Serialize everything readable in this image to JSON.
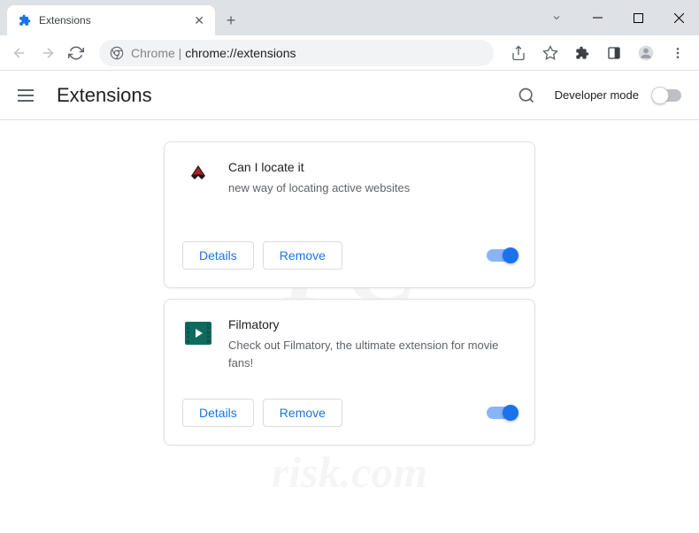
{
  "tab": {
    "title": "Extensions"
  },
  "address": {
    "prefix": "Chrome",
    "url": "chrome://extensions"
  },
  "header": {
    "title": "Extensions",
    "dev_mode": "Developer mode"
  },
  "buttons": {
    "details": "Details",
    "remove": "Remove"
  },
  "extensions": [
    {
      "name": "Can I locate it",
      "description": "new way of locating active websites",
      "enabled": true
    },
    {
      "name": "Filmatory",
      "description": "Check out Filmatory, the ultimate extension for movie fans!",
      "enabled": true
    }
  ],
  "watermark": {
    "big": "PC",
    "url": "risk.com"
  }
}
